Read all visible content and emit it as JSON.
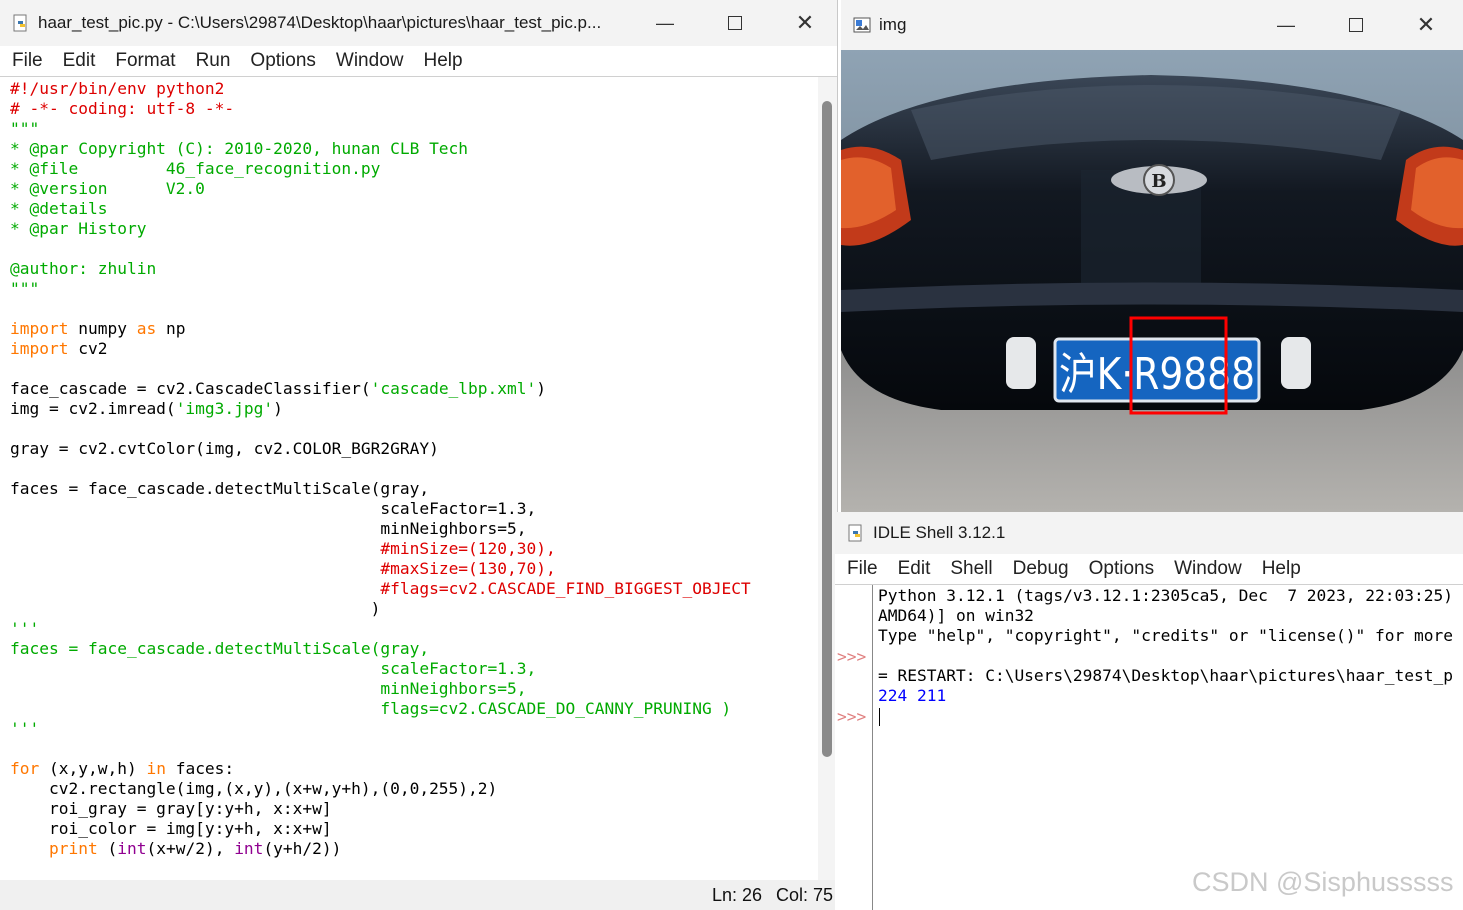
{
  "editor": {
    "title": "haar_test_pic.py - C:\\Users\\29874\\Desktop\\haar\\pictures\\haar_test_pic.p...",
    "menu": [
      "File",
      "Edit",
      "Format",
      "Run",
      "Options",
      "Window",
      "Help"
    ],
    "status_line": "Ln: 26",
    "status_col": "Col: 75"
  },
  "image_window": {
    "title": "img",
    "plate_text": "沪K·R9888"
  },
  "shell": {
    "title": "IDLE Shell 3.12.1",
    "menu": [
      "File",
      "Edit",
      "Shell",
      "Debug",
      "Options",
      "Window",
      "Help"
    ],
    "lines": [
      "Python 3.12.1 (tags/v3.12.1:2305ca5, Dec  7 2023, 22:03:25)",
      "AMD64)] on win32",
      "Type \"help\", \"copyright\", \"credits\" or \"license()\" for more",
      "",
      "= RESTART: C:\\Users\\29874\\Desktop\\haar\\pictures\\haar_test_p"
    ],
    "output": "224 211",
    "prompt": ">>>"
  },
  "watermark": "CSDN @Sisphusssss",
  "colors": {
    "keyword": "#ff7700",
    "string": "#00aa00",
    "comment": "#dd0000",
    "builtin": "#900090",
    "output": "#0000ff",
    "detect_box": "#ff0000",
    "plate": "#1565c0"
  },
  "icons": [
    "python-file-icon",
    "image-window-icon",
    "idle-shell-icon",
    "minimize-icon",
    "maximize-icon",
    "close-icon"
  ]
}
